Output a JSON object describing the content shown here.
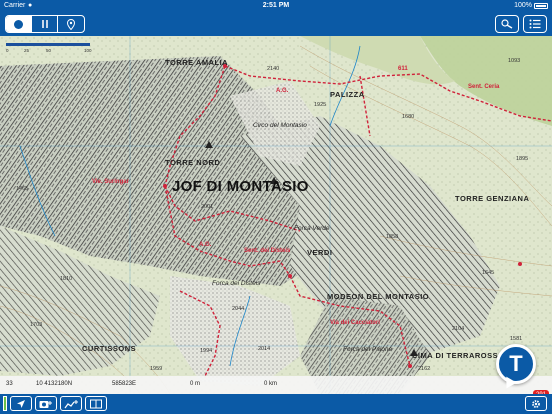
{
  "status_bar": {
    "carrier": "Carrier",
    "time": "2:51 PM",
    "battery": "100%"
  },
  "toolbar": {
    "record_icon": "record-icon",
    "pause_icon": "pause-icon",
    "waypoint_icon": "waypoint-pin-icon",
    "search_icon": "search-icon",
    "list_icon": "list-icon"
  },
  "map": {
    "scale_ticks": [
      "0",
      "25",
      "50",
      "100"
    ],
    "peak_name": "JOF DI MONTASIO",
    "labels": {
      "torre_amalia": "TORRE AMALIA",
      "palizza": "PALIZZA",
      "torre_nord": "TORRE NORD",
      "torre_genziana": "TORRE GENZIANA",
      "forca_verde": "Forca Verde",
      "verdi": "VERDI",
      "forca_disteis": "Forca dei Disteis",
      "modeon": "MODEON DEL MONTASIO",
      "curtissons": "CURTISSONS",
      "forca_palone": "Forca del Palone",
      "terrarossa": "CIMA DI TERRAROSSA",
      "circo_montasio": "Circo del Montasio"
    },
    "trails": {
      "ag_top": "A.G.",
      "ag_mid": "A.G.",
      "sunrise": "Vie. Suringar",
      "ceria": "Sent. Ceria",
      "trail_611": "611",
      "route_bottom": "Via dei Cacciatori",
      "trail_dist": "Sent. dei Disteis"
    },
    "elevations": [
      "1093",
      "2140",
      "1925",
      "1680",
      "1465",
      "2001",
      "1858",
      "1645",
      "2044",
      "1994",
      "2014",
      "1959",
      "2104",
      "1810",
      "2162",
      "1703",
      "1895",
      "1581"
    ],
    "colors": {
      "trail_red": "#d0223a",
      "water_blue": "#1d86c8",
      "rock_dark": "#2d2d2d"
    }
  },
  "coords_bar": {
    "zone": "33",
    "northing": "10  4132180N",
    "easting": "585823E",
    "altitude": "0 m",
    "time": "0 km"
  },
  "logo_icon": "tabacco-t-logo",
  "badge_count": "291",
  "bottom_toolbar": {
    "locate_icon": "location-arrow-icon",
    "camera_icon": "camera-add-icon",
    "track_icon": "track-add-icon",
    "map_icon": "map-book-icon",
    "settings_icon": "gear-icon"
  },
  "app_colors": {
    "bar_blue": "#0b5aa6",
    "gps_green": "#6ac04a",
    "badge_red": "#e02020"
  }
}
